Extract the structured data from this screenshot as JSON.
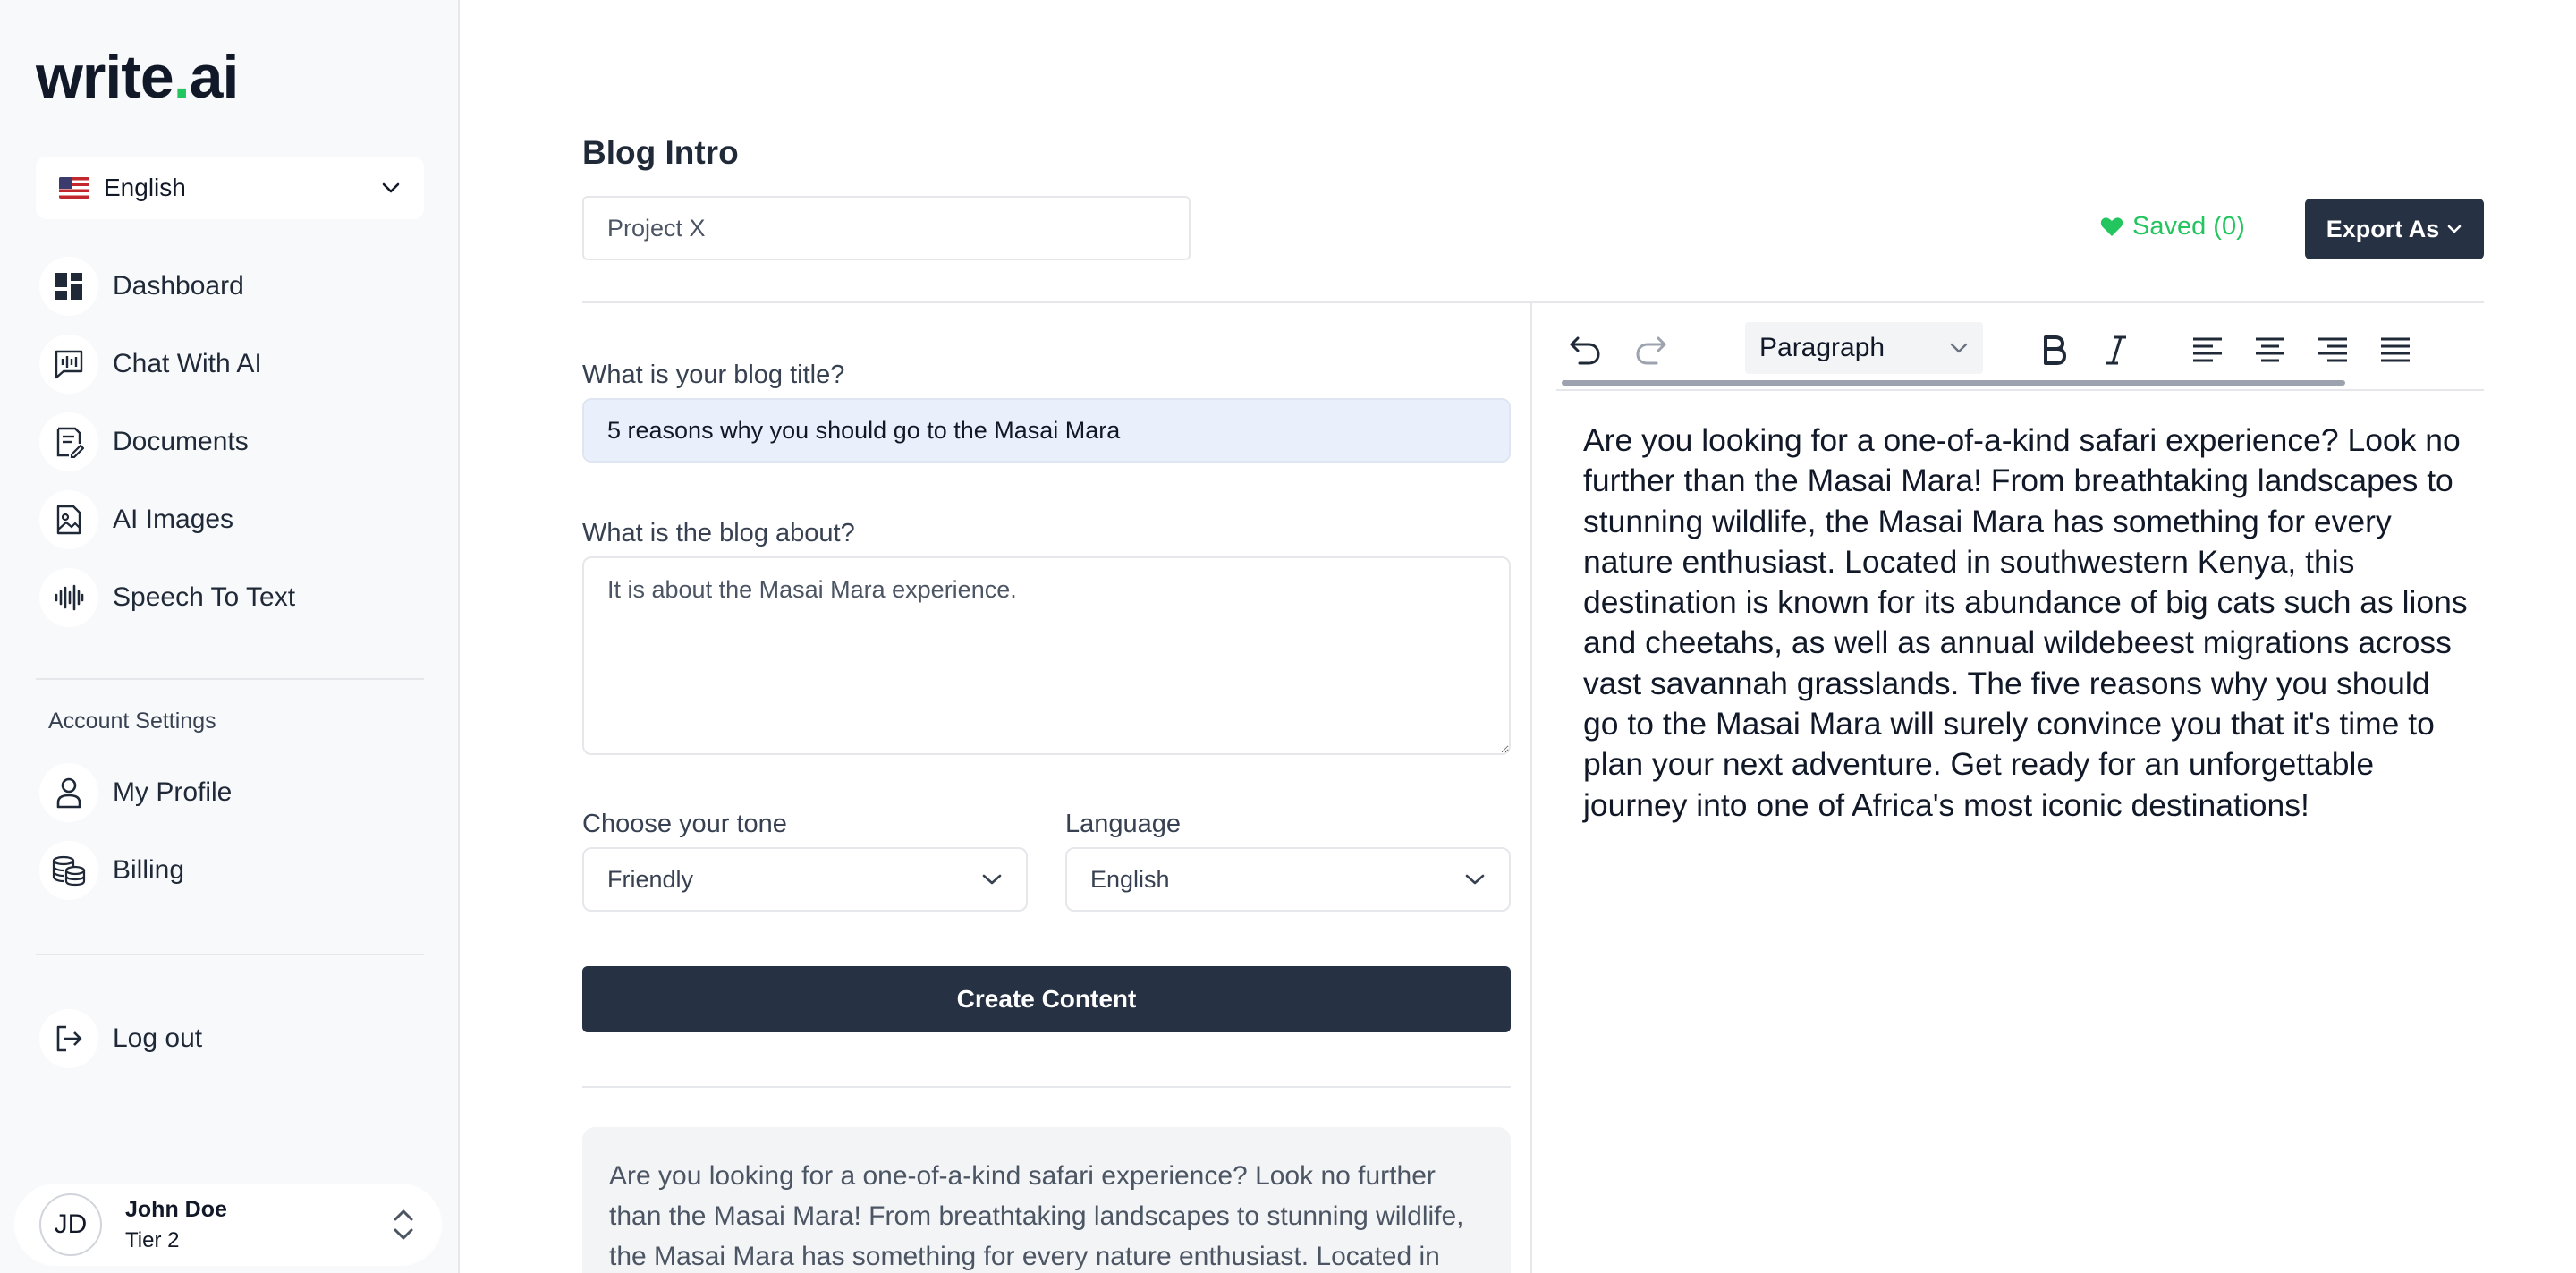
{
  "sidebar": {
    "logo_main": "write",
    "logo_dot": ".",
    "logo_end": "ai",
    "language": "English",
    "nav": [
      {
        "label": "Dashboard",
        "icon": "dashboard-icon"
      },
      {
        "label": "Chat With AI",
        "icon": "chat-icon"
      },
      {
        "label": "Documents",
        "icon": "documents-icon"
      },
      {
        "label": "AI Images",
        "icon": "image-icon"
      },
      {
        "label": "Speech To Text",
        "icon": "audio-wave-icon"
      }
    ],
    "account_section_title": "Account Settings",
    "account_nav": [
      {
        "label": "My Profile",
        "icon": "user-icon"
      },
      {
        "label": "Billing",
        "icon": "coins-icon"
      }
    ],
    "logout_label": "Log out",
    "user": {
      "initials": "JD",
      "name": "John Doe",
      "tier": "Tier 2"
    }
  },
  "header": {
    "page_title": "Blog Intro",
    "project_name": "Project X",
    "saved_label": "Saved (0)",
    "export_label": "Export As"
  },
  "form": {
    "title_label": "What is your blog title?",
    "title_value": "5 reasons why you should go to the Masai Mara",
    "about_label": "What is the blog about?",
    "about_value": "It is about the Masai Mara experience.",
    "tone_label": "Choose your tone",
    "tone_value": "Friendly",
    "language_label": "Language",
    "language_value": "English",
    "create_label": "Create Content",
    "preview_text": "Are you looking for a one-of-a-kind safari experience? Look no further than the Masai Mara! From breathtaking landscapes to stunning wildlife, the Masai Mara has something for every nature enthusiast. Located in southwestern Kenya, this destination is known for its abundance of big cats such as lions and cheetahs, as well as annual wildebeest migrations across vast savannah grasslands."
  },
  "editor": {
    "block_format": "Paragraph",
    "content": "Are you looking for a one-of-a-kind safari experience? Look no further than the Masai Mara! From breathtaking landscapes to stunning wildlife, the Masai Mara has something for every nature enthusiast. Located in southwestern Kenya, this destination is known for its abundance of big cats such as lions and cheetahs, as well as annual wildebeest migrations across vast savannah grasslands. The five reasons why you should go to the Masai Mara will surely convince you that it's time to plan your next adventure. Get ready for an unforgettable journey into one of Africa's most iconic destinations!"
  },
  "colors": {
    "accent_green": "#22c55e",
    "button_dark": "#263143",
    "sidebar_bg": "#f8f9fb"
  }
}
